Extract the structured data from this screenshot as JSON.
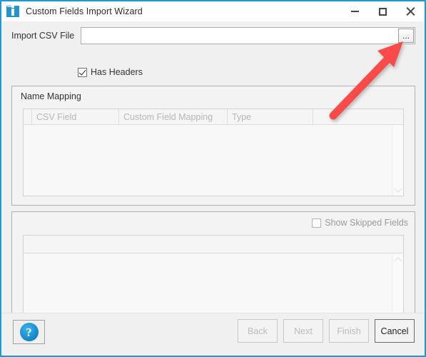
{
  "window": {
    "title": "Custom Fields Import Wizard",
    "icon": "custom-field-icon",
    "border_color": "#1b9ad6",
    "controls": {
      "minimize": "minimize-icon",
      "maximize": "maximize-icon",
      "close": "close-icon"
    }
  },
  "form": {
    "file_label": "Import CSV File",
    "file_value": "",
    "file_placeholder": "",
    "browse_label": "...",
    "has_headers_label": "Has Headers",
    "has_headers_checked": true
  },
  "name_mapping": {
    "title": "Name Mapping",
    "columns": [
      "",
      "CSV Field",
      "Custom Field Mapping",
      "Type",
      ""
    ],
    "rows": []
  },
  "skipped": {
    "checkbox_label": "Show Skipped Fields",
    "checkbox_checked": false,
    "checkbox_disabled": true,
    "columns": [
      ""
    ],
    "rows": []
  },
  "footer": {
    "help_label": "?",
    "buttons": [
      {
        "label": "Back",
        "enabled": false
      },
      {
        "label": "Next",
        "enabled": false
      },
      {
        "label": "Finish",
        "enabled": false
      },
      {
        "label": "Cancel",
        "enabled": true
      }
    ]
  },
  "annotation": {
    "type": "arrow",
    "color": "#fa4b48",
    "points_to": "browse-button"
  }
}
